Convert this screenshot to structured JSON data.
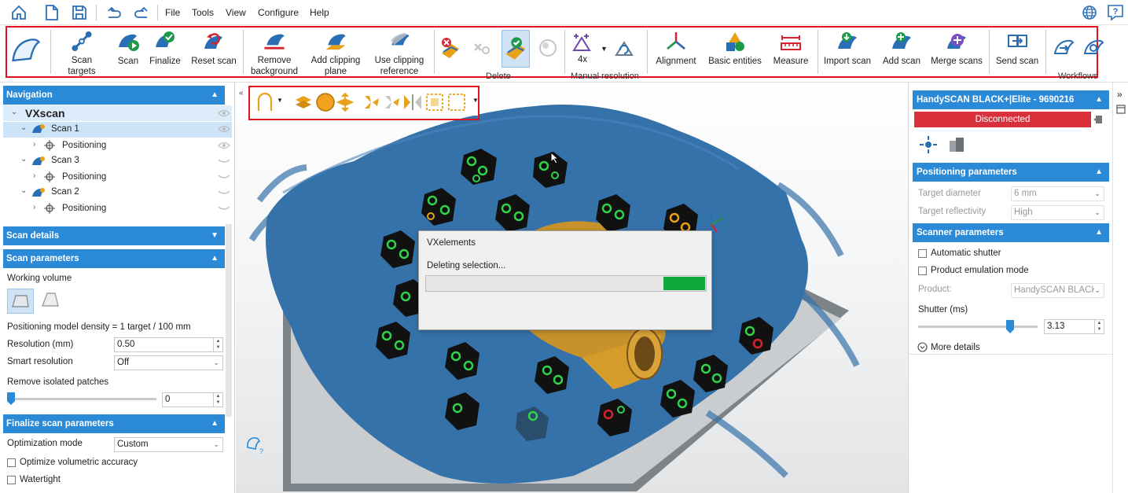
{
  "menu": [
    "File",
    "Tools",
    "View",
    "Configure",
    "Help"
  ],
  "quick_access": [
    "home-icon",
    "new-file-icon",
    "save-icon",
    "undo-icon",
    "redo-icon"
  ],
  "ribbon": {
    "buttons": [
      {
        "name": "scan-targets",
        "label": "Scan targets"
      },
      {
        "name": "scan",
        "label": "Scan"
      },
      {
        "name": "finalize",
        "label": "Finalize"
      },
      {
        "name": "reset-scan",
        "label": "Reset scan"
      },
      {
        "name": "remove-background",
        "label": "Remove background"
      },
      {
        "name": "add-clipping-plane",
        "label": "Add clipping plane"
      },
      {
        "name": "use-clipping-reference",
        "label": "Use clipping reference"
      },
      {
        "name": "alignment",
        "label": "Alignment"
      },
      {
        "name": "basic-entities",
        "label": "Basic entities"
      },
      {
        "name": "measure",
        "label": "Measure"
      },
      {
        "name": "import-scan",
        "label": "Import scan"
      },
      {
        "name": "add-scan",
        "label": "Add scan"
      },
      {
        "name": "merge-scans",
        "label": "Merge scans"
      },
      {
        "name": "send-scan",
        "label": "Send scan"
      }
    ],
    "delete_group": "Delete",
    "manual_resolution_group": "Manual resolution",
    "manual_resolution_value": "4x",
    "workflows_group": "Workflows",
    "accent_red": "#e0141e"
  },
  "navigation": {
    "header": "Navigation",
    "root": "VXscan",
    "items": [
      {
        "label": "Scan 1",
        "child": "Positioning",
        "selected": true
      },
      {
        "label": "Scan 3",
        "child": "Positioning",
        "selected": false
      },
      {
        "label": "Scan 2",
        "child": "Positioning",
        "selected": false
      }
    ]
  },
  "scan_details": {
    "header": "Scan details"
  },
  "scan_parameters": {
    "header": "Scan parameters",
    "working_volume_label": "Working volume",
    "density_text": "Positioning model density = 1 target / 100 mm",
    "resolution_label": "Resolution (mm)",
    "resolution_value": "0.50",
    "smart_resolution_label": "Smart resolution",
    "smart_resolution_value": "Off",
    "remove_isolated_label": "Remove isolated patches",
    "remove_isolated_value": "0"
  },
  "finalize_parameters": {
    "header": "Finalize scan parameters",
    "optimization_label": "Optimization mode",
    "optimization_value": "Custom",
    "optimize_volumetric": "Optimize volumetric accuracy",
    "watertight": "Watertight"
  },
  "dialog": {
    "title": "VXelements",
    "message": "Deleting selection...",
    "progress": 0.15,
    "progress_color": "#10a83a"
  },
  "device": {
    "name": "HandySCAN BLACK+|Elite - 9690216",
    "status": "Disconnected",
    "status_color": "#d8313b"
  },
  "positioning_parameters": {
    "header": "Positioning parameters",
    "target_diameter_label": "Target diameter",
    "target_diameter_value": "6 mm",
    "target_reflectivity_label": "Target reflectivity",
    "target_reflectivity_value": "High"
  },
  "scanner_parameters": {
    "header": "Scanner parameters",
    "automatic_shutter": "Automatic shutter",
    "product_emulation": "Product emulation mode",
    "product_label": "Product:",
    "product_value": "HandySCAN BLACK|",
    "shutter_label": "Shutter (ms)",
    "shutter_value": "3.13",
    "more_details": "More details"
  }
}
